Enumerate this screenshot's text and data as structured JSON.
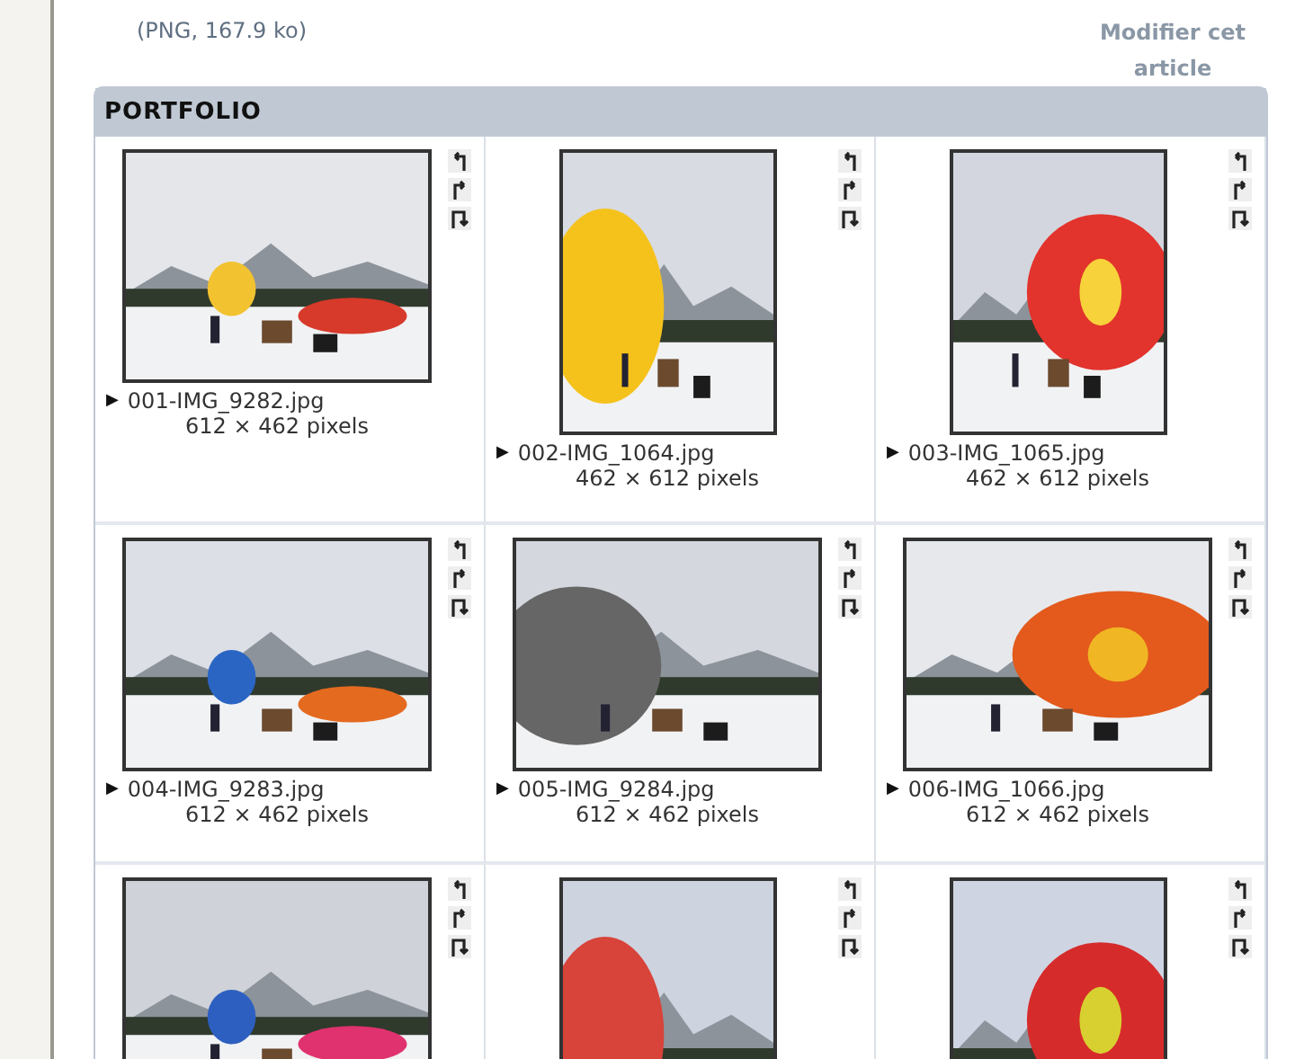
{
  "attachment": {
    "info": "(PNG, 167.9 ko)"
  },
  "edit_link": "Modifier cet article",
  "portfolio": {
    "title": "PORTFOLIO",
    "items": [
      {
        "kind": "landscape",
        "marker": "▶",
        "filename": "001-IMG_9282.jpg",
        "dimensions": "612 × 462 pixels"
      },
      {
        "kind": "portrait",
        "marker": "▶",
        "filename": "002-IMG_1064.jpg",
        "dimensions": "462 × 612 pixels"
      },
      {
        "kind": "portrait",
        "marker": "▶",
        "filename": "003-IMG_1065.jpg",
        "dimensions": "462 × 612 pixels"
      },
      {
        "kind": "landscape",
        "marker": "▶",
        "filename": "004-IMG_9283.jpg",
        "dimensions": "612 × 462 pixels"
      },
      {
        "kind": "landscape",
        "marker": "▶",
        "filename": "005-IMG_9284.jpg",
        "dimensions": "612 × 462 pixels"
      },
      {
        "kind": "landscape",
        "marker": "▶",
        "filename": "006-IMG_1066.jpg",
        "dimensions": "612 × 462 pixels"
      },
      {
        "kind": "landscape"
      },
      {
        "kind": "portrait"
      },
      {
        "kind": "portrait"
      }
    ]
  }
}
